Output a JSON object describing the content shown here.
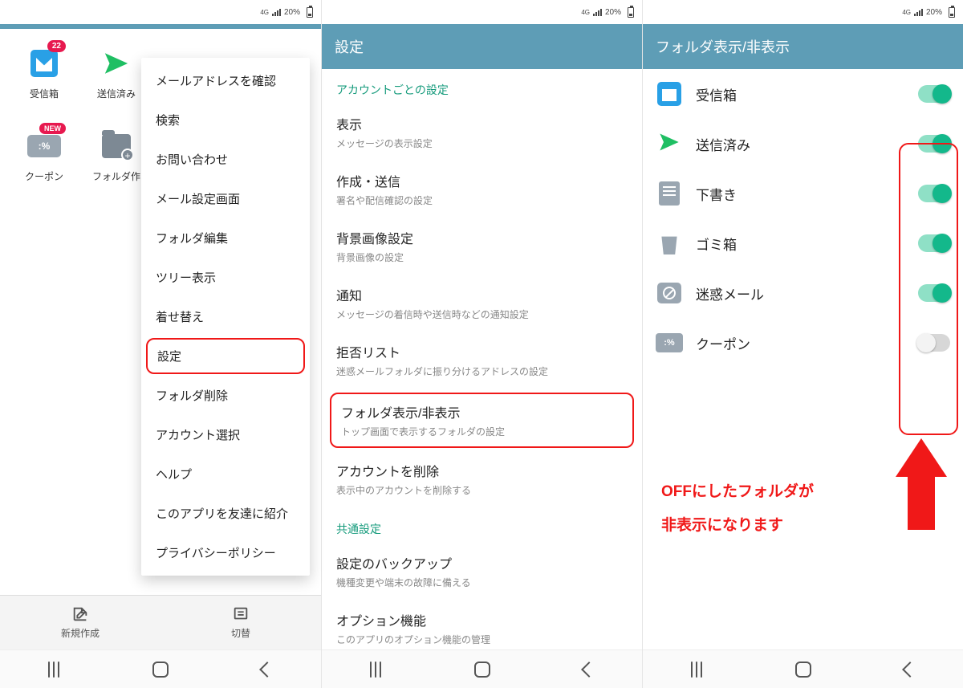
{
  "status": {
    "network": "4G",
    "signal": "∴",
    "battery_pct": "20%"
  },
  "screen1": {
    "folders": {
      "inbox": {
        "label": "受信箱",
        "badge": "22"
      },
      "sent": {
        "label": "送信済み"
      },
      "coupon": {
        "label": "クーポン",
        "badge": "NEW"
      },
      "folder_create": {
        "label": "フォルダ作"
      }
    },
    "menu": [
      "メールアドレスを確認",
      "検索",
      "お問い合わせ",
      "メール設定画面",
      "フォルダ編集",
      "ツリー表示",
      "着せ替え",
      "設定",
      "フォルダ削除",
      "アカウント選択",
      "ヘルプ",
      "このアプリを友達に紹介",
      "プライバシーポリシー"
    ],
    "menu_highlight_index": 7,
    "bottom": {
      "compose": "新規作成",
      "switch": "切替"
    }
  },
  "screen2": {
    "title": "設定",
    "section_account": "アカウントごとの設定",
    "rows_account": [
      {
        "title": "表示",
        "sub": "メッセージの表示設定"
      },
      {
        "title": "作成・送信",
        "sub": "署名や配信確認の設定"
      },
      {
        "title": "背景画像設定",
        "sub": "背景画像の設定"
      },
      {
        "title": "通知",
        "sub": "メッセージの着信時や送信時などの通知設定"
      },
      {
        "title": "拒否リスト",
        "sub": "迷惑メールフォルダに振り分けるアドレスの設定"
      },
      {
        "title": "フォルダ表示/非表示",
        "sub": "トップ画面で表示するフォルダの設定"
      },
      {
        "title": "アカウントを削除",
        "sub": "表示中のアカウントを削除する"
      }
    ],
    "rows_account_highlight_index": 5,
    "section_common": "共通設定",
    "rows_common": [
      {
        "title": "設定のバックアップ",
        "sub": "機種変更や端末の故障に備える"
      },
      {
        "title": "オプション機能",
        "sub": "このアプリのオプション機能の管理"
      }
    ]
  },
  "screen3": {
    "title": "フォルダ表示/非表示",
    "rows": [
      {
        "key": "inbox",
        "label": "受信箱",
        "on": true
      },
      {
        "key": "sent",
        "label": "送信済み",
        "on": true
      },
      {
        "key": "draft",
        "label": "下書き",
        "on": true
      },
      {
        "key": "trash",
        "label": "ゴミ箱",
        "on": true
      },
      {
        "key": "spam",
        "label": "迷惑メール",
        "on": true
      },
      {
        "key": "coupon",
        "label": "クーポン",
        "on": false
      }
    ]
  },
  "annotation": {
    "line1": "OFFにしたフォルダが",
    "line2": "非表示になります"
  }
}
